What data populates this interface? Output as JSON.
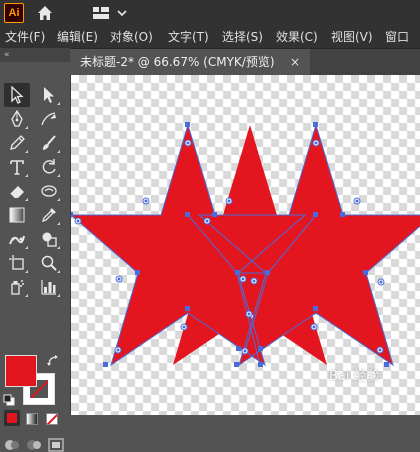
{
  "app": {
    "logo_text": "Ai"
  },
  "topbar": {
    "home_icon": "home-icon",
    "workspace_icon": "workspace-switcher-icon"
  },
  "menu": {
    "items": [
      {
        "label": "文件(F)"
      },
      {
        "label": "编辑(E)"
      },
      {
        "label": "对象(O)"
      },
      {
        "label": "文字(T)"
      },
      {
        "label": "选择(S)"
      },
      {
        "label": "效果(C)"
      },
      {
        "label": "视图(V)"
      },
      {
        "label": "窗口"
      }
    ]
  },
  "document": {
    "tab_title": "未标题-2* @ 66.67% (CMYK/预览)",
    "close_glyph": "×"
  },
  "toolbox": {
    "collapse_glyph": "«",
    "tools": [
      "selection-tool",
      "direct-selection-tool",
      "pen-tool",
      "curvature-tool",
      "pencil-tool",
      "paintbrush-tool",
      "type-tool",
      "rotate-tool",
      "eraser-tool",
      "warp-tool",
      "gradient-tool",
      "eyedropper-tool",
      "puppet-warp-tool",
      "shape-builder-tool",
      "artboard-tool",
      "zoom-tool",
      "symbol-sprayer-tool",
      "column-graph-tool"
    ]
  },
  "colors": {
    "fill": "#E3161F",
    "stroke": "none",
    "selection": "#4A6BDB"
  },
  "watermark": {
    "text": "Bai 经验"
  }
}
